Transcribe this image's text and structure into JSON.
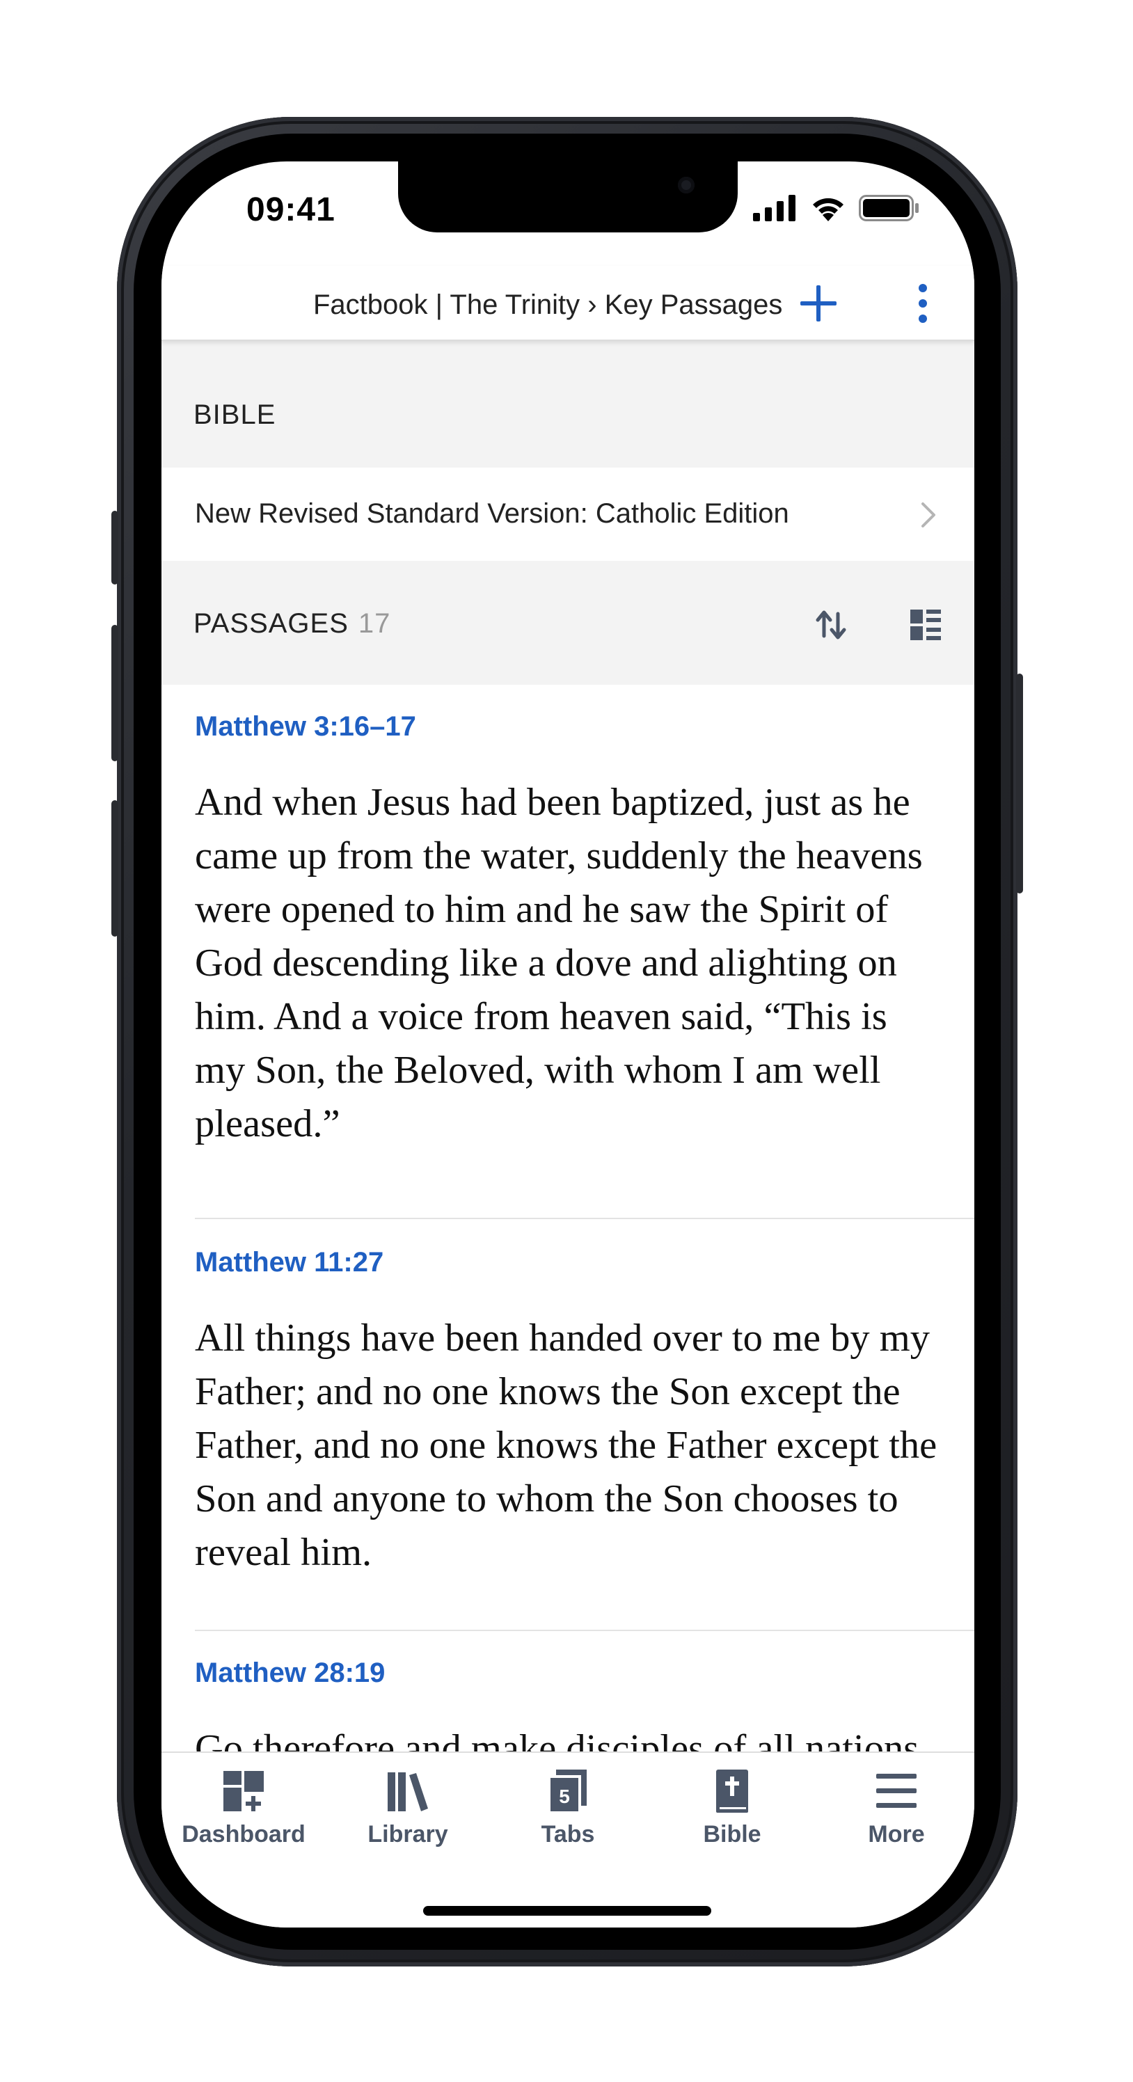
{
  "status_bar": {
    "time": "09:41",
    "icons": [
      "signal-icon",
      "wifi-icon",
      "battery-icon"
    ]
  },
  "nav": {
    "title": "Factbook | The Trinity › Key Passages",
    "add_icon": "plus-icon",
    "more_icon": "vertical-ellipsis-icon"
  },
  "bible_section": {
    "header": "BIBLE",
    "selected_bible": "New Revised Standard Version: Catholic Edition"
  },
  "passages_section": {
    "header": "PASSAGES",
    "count": "17",
    "sort_icon": "sort-icon",
    "view_icon": "list-view-icon",
    "items": [
      {
        "reference": "Matthew 3:16–17",
        "text": "And when Jesus had been baptized, just as he came up from the water, suddenly the heavens were opened to him and he saw the Spirit of God descending like a dove and alighting on him. And a voice from heaven said, “This is my Son, the Beloved, with whom I am well pleased.”"
      },
      {
        "reference": "Matthew 11:27",
        "text": "All things have been handed over to me by my Father; and no one knows the Son except the Father, and no one knows the Father except the Son and anyone to whom the Son chooses to reveal him."
      },
      {
        "reference": "Matthew 28:19",
        "text": "Go therefore and make disciples of all nations, baptizing them in the name of the"
      }
    ]
  },
  "tab_bar": {
    "tabs": [
      {
        "label": "Dashboard",
        "icon": "dashboard-icon"
      },
      {
        "label": "Library",
        "icon": "library-icon"
      },
      {
        "label": "Tabs",
        "icon": "tabs-icon",
        "badge": "5"
      },
      {
        "label": "Bible",
        "icon": "bible-icon"
      },
      {
        "label": "More",
        "icon": "menu-icon"
      }
    ]
  },
  "colors": {
    "accent": "#1f5fc2",
    "tab_icon": "#4b5668",
    "section_bg": "#f3f3f3"
  }
}
